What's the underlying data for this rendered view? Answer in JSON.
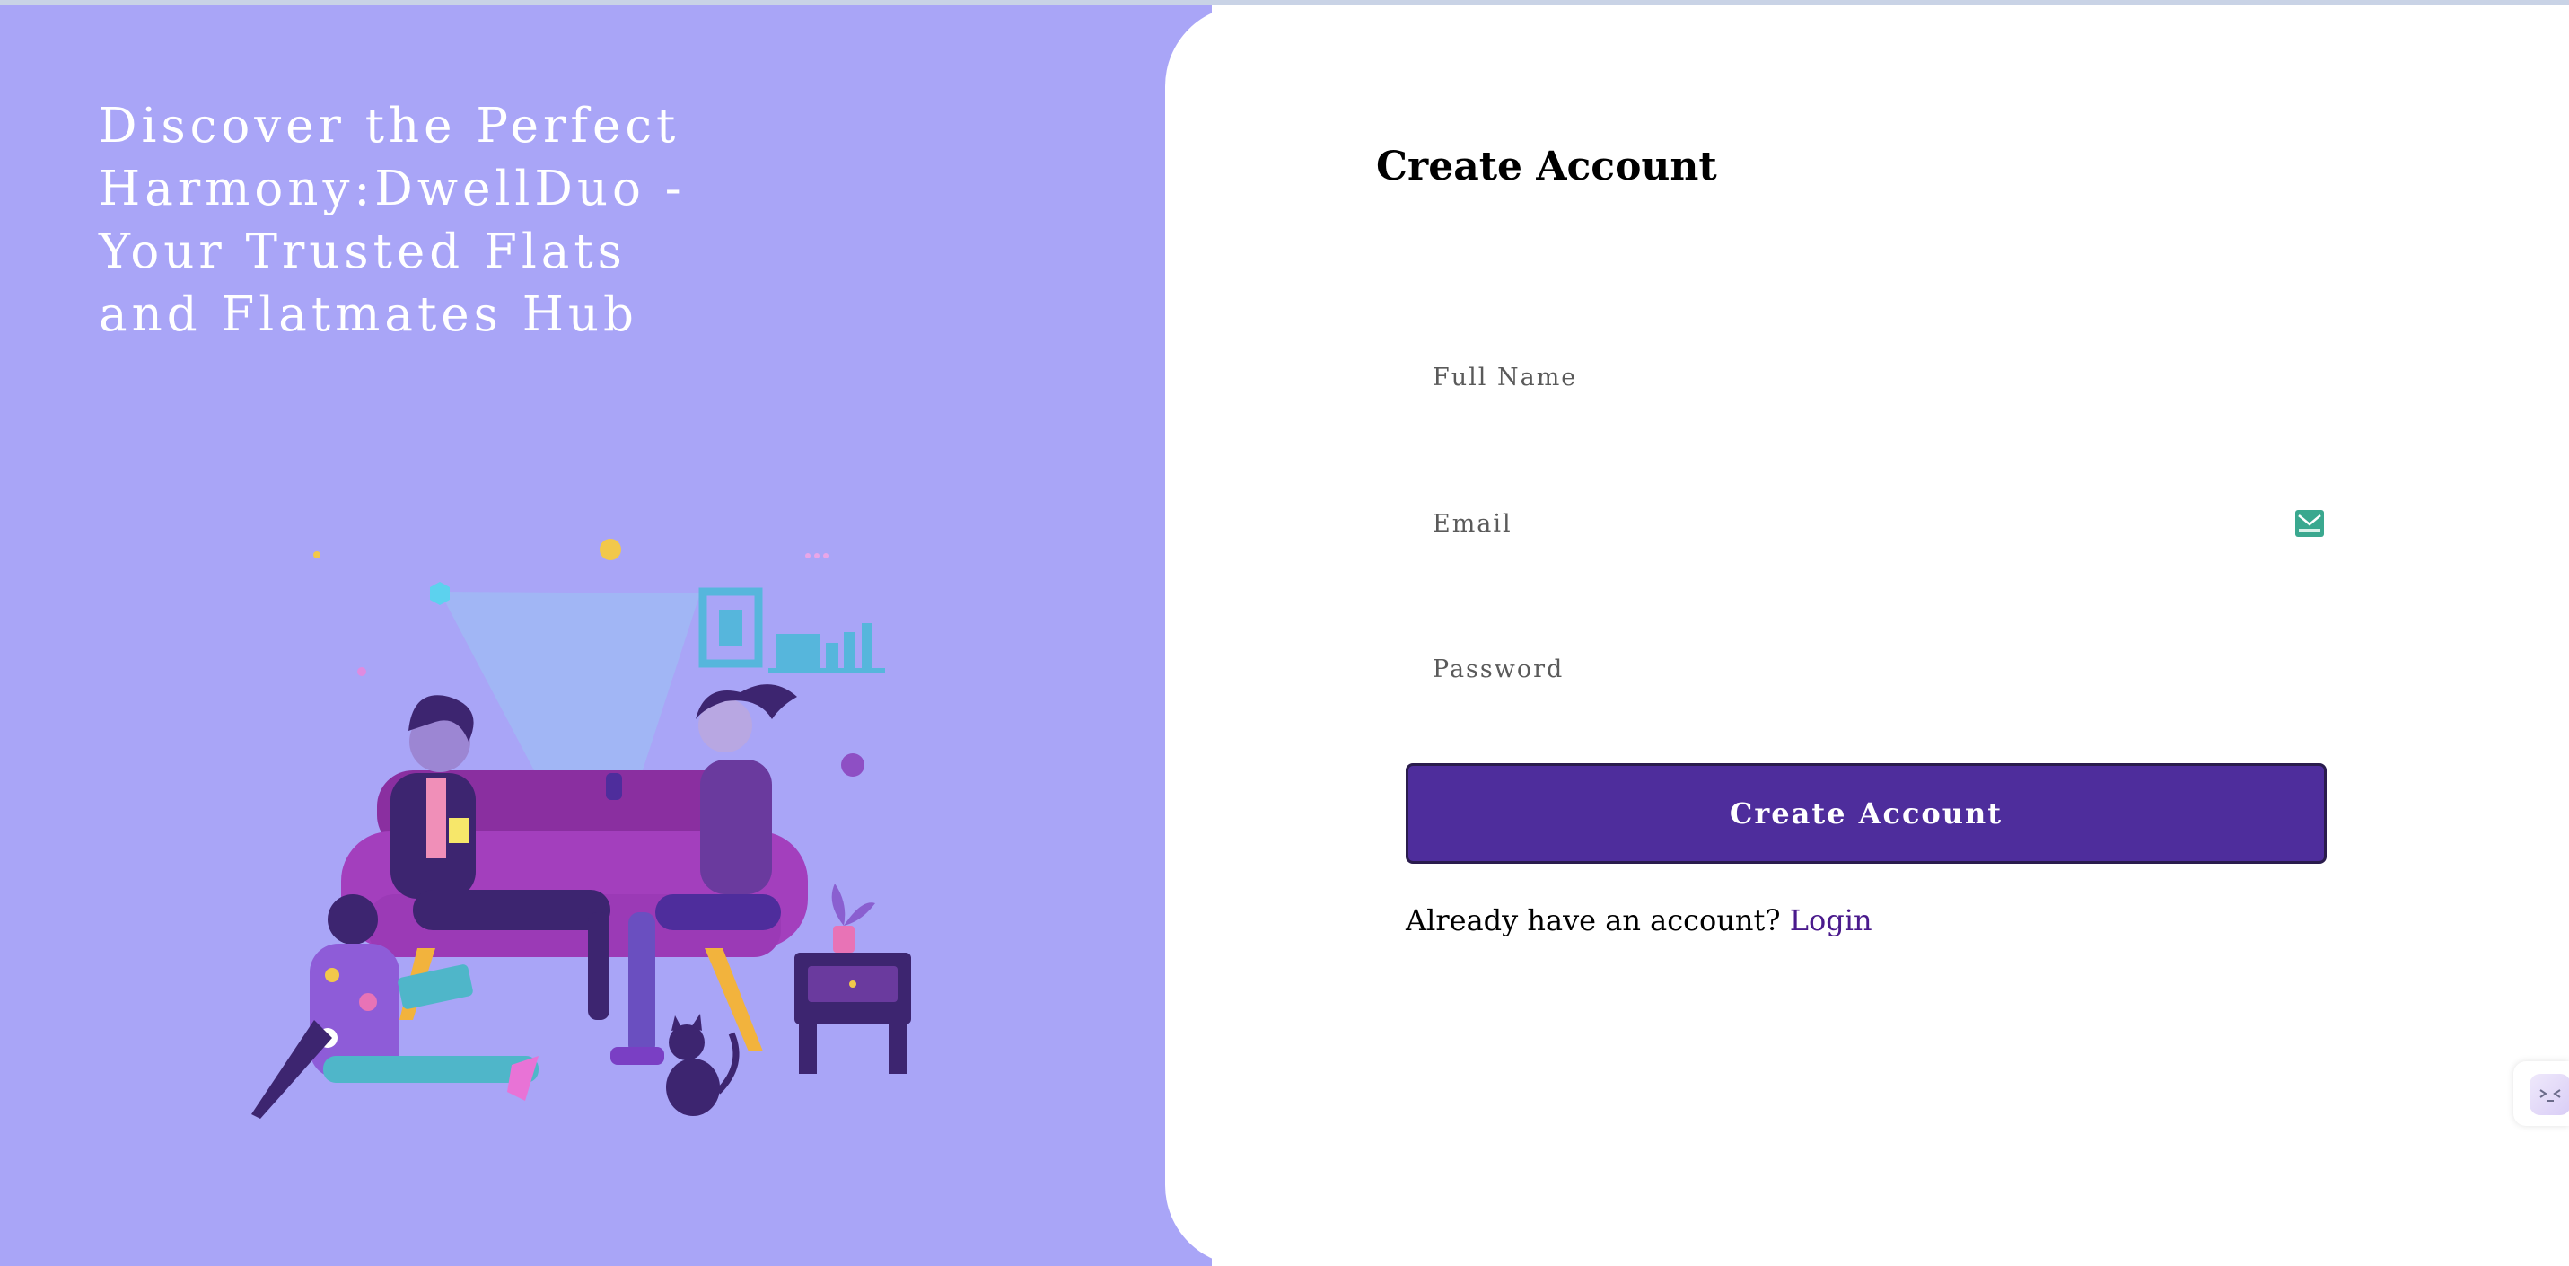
{
  "hero": {
    "headline": "Discover the Perfect Harmony:DwellDuo - Your Trusted Flats and Flatmates Hub",
    "illustration": "roommates-on-sofa-illustration"
  },
  "form": {
    "title": "Create Account",
    "full_name": {
      "placeholder": "Full Name",
      "value": ""
    },
    "email": {
      "placeholder": "Email",
      "value": "",
      "badge_icon": "mail-badge-icon"
    },
    "password": {
      "placeholder": "Password",
      "value": ""
    },
    "submit_label": "Create Account",
    "login_prompt": "Already have an account?",
    "login_link": "Login"
  },
  "widget": {
    "icon": "assistant-face-icon"
  },
  "colors": {
    "hero_background": "#a9a5f7",
    "button": "#4e2d9c",
    "link": "#4a1a8c",
    "panel": "#ffffff"
  }
}
